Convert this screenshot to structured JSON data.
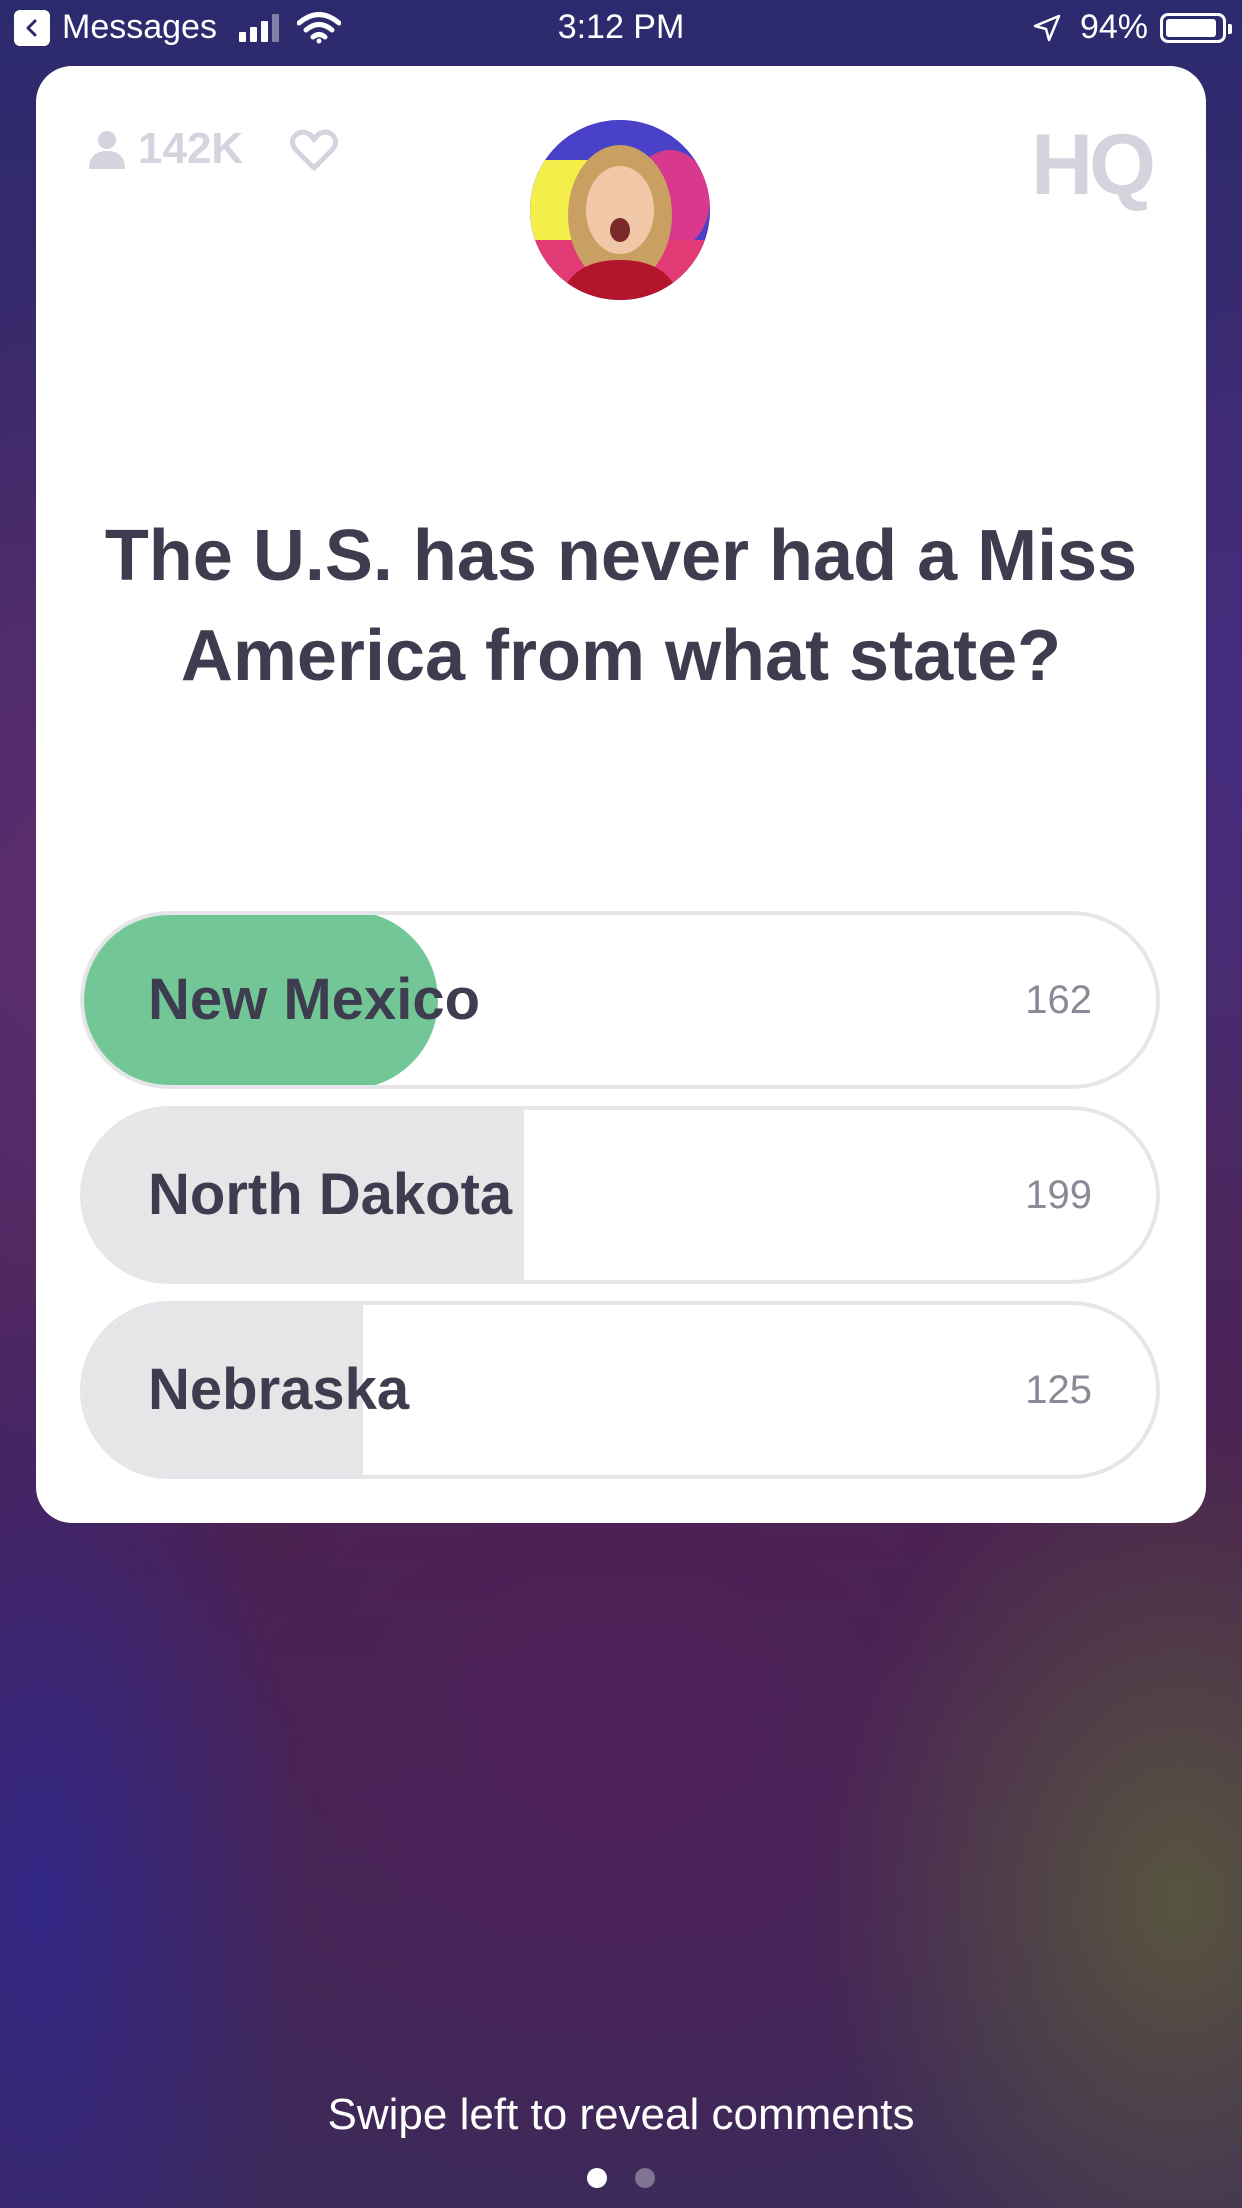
{
  "status_bar": {
    "back_label": "Messages",
    "time": "3:12 PM",
    "battery": "94%",
    "battery_level": 0.94
  },
  "header": {
    "viewer_count": "142K",
    "logo": "HQ"
  },
  "question": "The U.S. has never had a Miss America from what state?",
  "answers": [
    {
      "label": "New Mexico",
      "count": "162",
      "correct": true,
      "share": 0.33
    },
    {
      "label": "North Dakota",
      "count": "199",
      "correct": false,
      "share": 0.41
    },
    {
      "label": "Nebraska",
      "count": "125",
      "correct": false,
      "share": 0.26
    }
  ],
  "footer": {
    "swipe_hint": "Swipe left to reveal comments"
  },
  "colors": {
    "correct": "#73c796",
    "text": "#3d3d4f",
    "muted": "#d4d3de"
  }
}
